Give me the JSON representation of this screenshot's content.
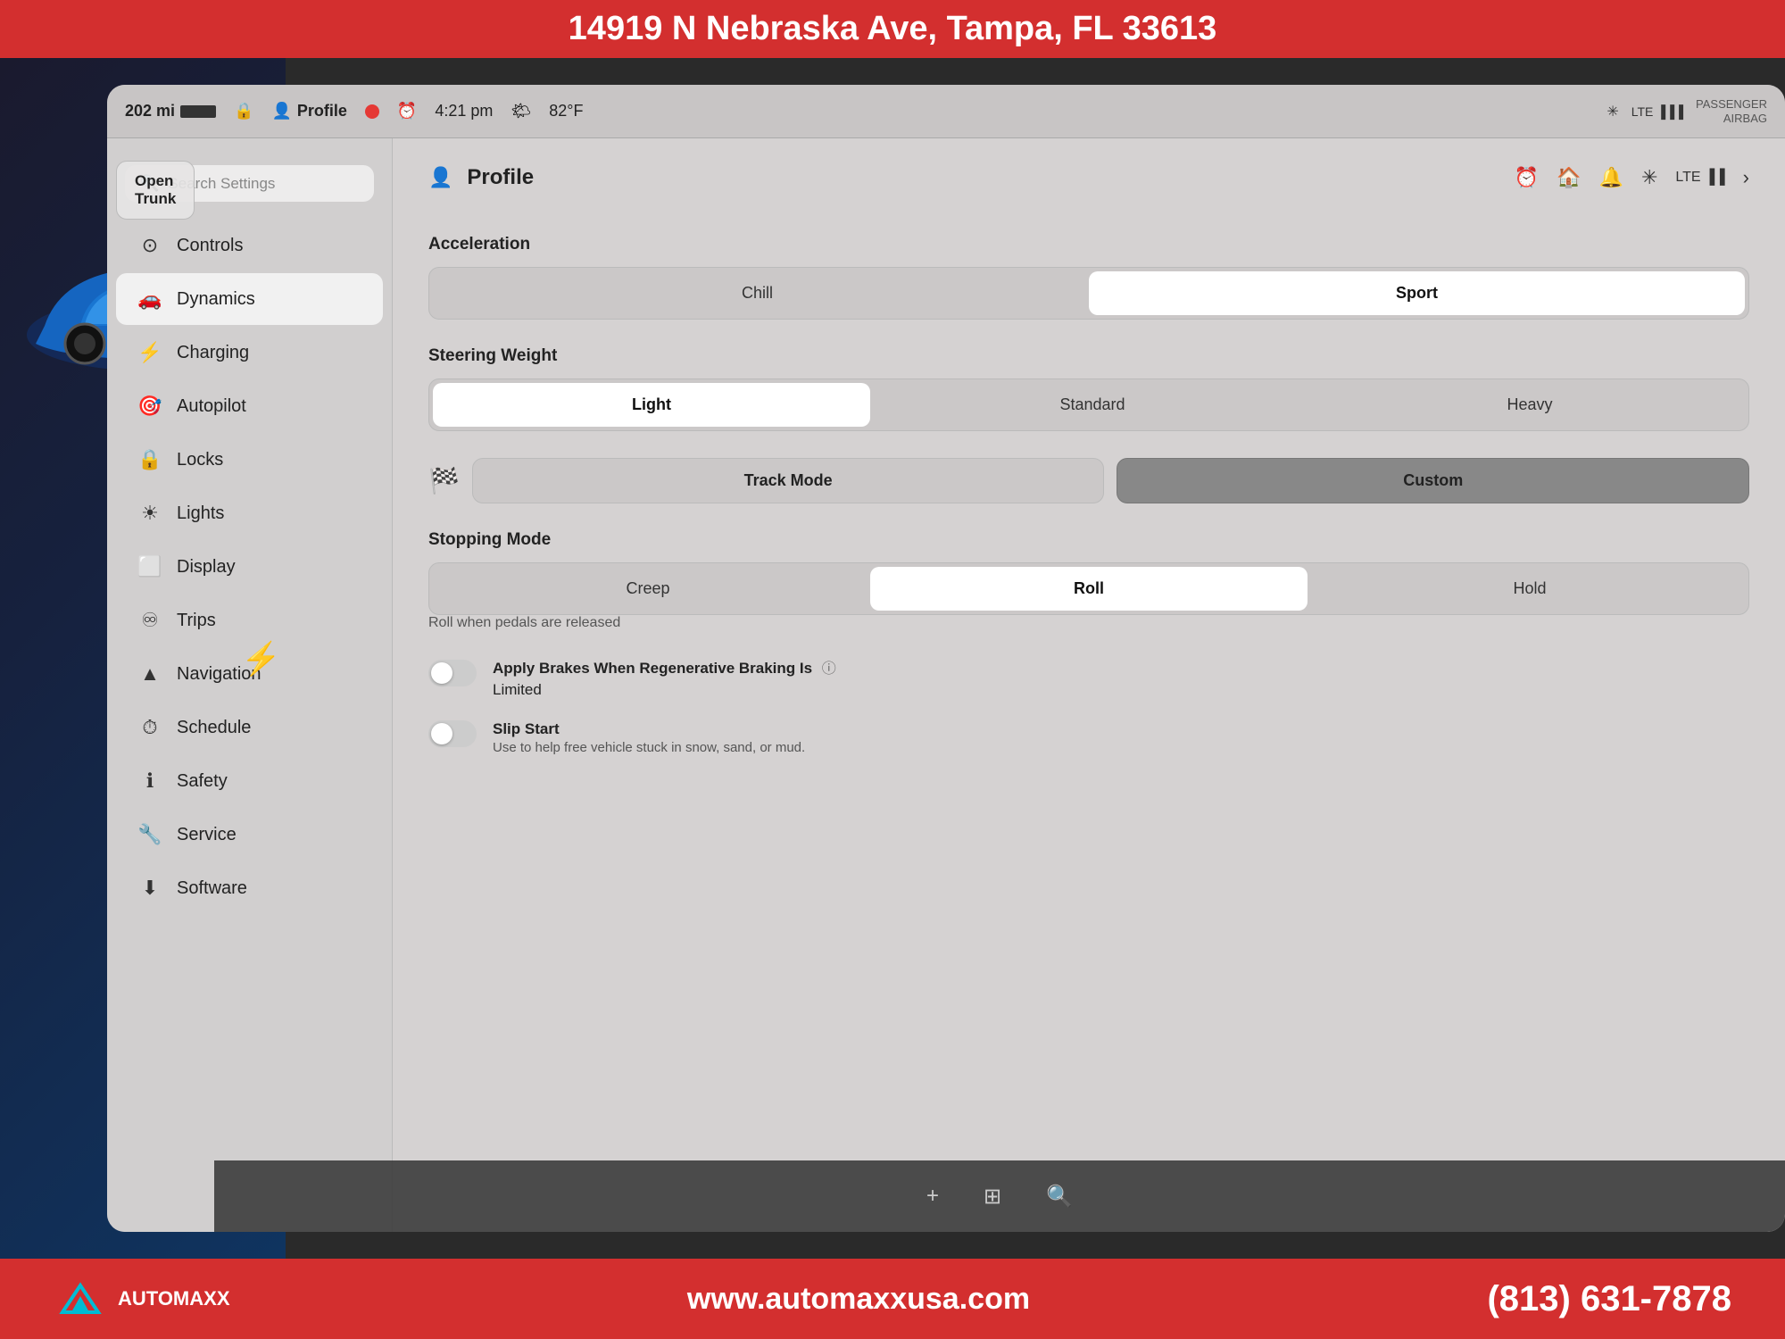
{
  "top_banner": {
    "text": "14919 N Nebraska Ave, Tampa, FL 33613"
  },
  "bottom_banner": {
    "website": "www.automaxxusa.com",
    "phone": "(813) 631-7878",
    "logo_text": "AUTOMAXX"
  },
  "status_bar": {
    "mileage": "202 mi",
    "lock_icon": "🔒",
    "profile_label": "Profile",
    "record_dot": "●",
    "time": "4:21 pm",
    "temperature": "82°F",
    "passenger_airbag": "PASSENGER\nAIRBAG",
    "lte_label": "LTE"
  },
  "search": {
    "placeholder": "Search Settings"
  },
  "nav_items": [
    {
      "icon": "⊙",
      "label": "Controls",
      "active": false
    },
    {
      "icon": "🚗",
      "label": "Dynamics",
      "active": true
    },
    {
      "icon": "⚡",
      "label": "Charging",
      "active": false
    },
    {
      "icon": "🎯",
      "label": "Autopilot",
      "active": false
    },
    {
      "icon": "🔒",
      "label": "Locks",
      "active": false
    },
    {
      "icon": "☀",
      "label": "Lights",
      "active": false
    },
    {
      "icon": "⬜",
      "label": "Display",
      "active": false
    },
    {
      "icon": "♾",
      "label": "Trips",
      "active": false
    },
    {
      "icon": "▲",
      "label": "Navigation",
      "active": false
    },
    {
      "icon": "⏱",
      "label": "Schedule",
      "active": false
    },
    {
      "icon": "ℹ",
      "label": "Safety",
      "active": false
    },
    {
      "icon": "🔧",
      "label": "Service",
      "active": false
    },
    {
      "icon": "⬇",
      "label": "Software",
      "active": false
    }
  ],
  "profile_panel": {
    "title": "Profile",
    "icons": [
      "⏰",
      "🏠",
      "🔔",
      "✳",
      "LTE"
    ]
  },
  "dynamics": {
    "acceleration_title": "Acceleration",
    "acceleration_options": [
      "Chill",
      "Sport"
    ],
    "acceleration_selected": "Sport",
    "steering_title": "Steering Weight",
    "steering_options": [
      "Light",
      "Standard",
      "Heavy"
    ],
    "steering_selected": "Light",
    "track_mode_label": "Track Mode",
    "custom_label": "Custom",
    "stopping_mode_title": "Stopping Mode",
    "stopping_options": [
      "Creep",
      "Roll",
      "Hold"
    ],
    "stopping_selected": "Roll",
    "stopping_hint": "Roll when pedals are released",
    "apply_brakes_label": "Apply Brakes When Regenerative Braking Is",
    "apply_brakes_label2": "Limited",
    "slip_start_label": "Slip Start",
    "slip_start_hint": "Use to help free vehicle stuck in snow, sand, or mud."
  },
  "open_trunk": {
    "label": "Open\nTrunk"
  },
  "taskbar": {
    "plus_icon": "+",
    "eq_icon": "⊞",
    "search_icon": "🔍"
  }
}
